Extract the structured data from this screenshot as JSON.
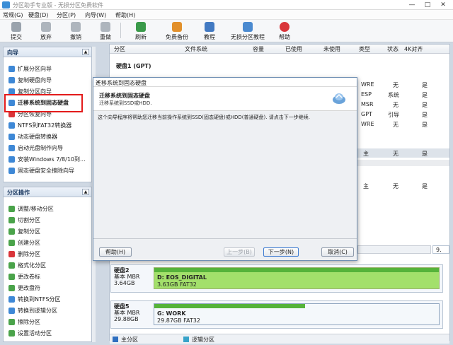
{
  "window": {
    "title": "分区助手专业版 - 无损分区免费软件",
    "minimize": "—",
    "maximize": "□",
    "close": "✕"
  },
  "menu": [
    "常规(G)",
    "硬盘(D)",
    "分区(P)",
    "向导(W)",
    "帮助(H)"
  ],
  "toolbar": [
    "提交",
    "放弃",
    "撤销",
    "重做",
    "刷新",
    "免费备份",
    "教程",
    "无损分区教程",
    "帮助"
  ],
  "wizard_panel": {
    "title": "向导",
    "items": [
      "扩展分区向导",
      "复制硬盘向导",
      "复制分区向导",
      "迁移系统到固态硬盘",
      "分区恢复向导",
      "NTFS到FAT32转换器",
      "动态硬盘转换器",
      "启动光盘制作向导",
      "安装Windows 7/8/10到...",
      "固态硬盘安全擦除向导"
    ]
  },
  "ops_panel": {
    "title": "分区操作",
    "items": [
      "调整/移动分区",
      "切割分区",
      "复制分区",
      "创建分区",
      "删除分区",
      "格式化分区",
      "更改卷标",
      "更改盘符",
      "转换到NTFS分区",
      "转换到逻辑分区",
      "擦除分区",
      "设置活动分区"
    ]
  },
  "table": {
    "columns": [
      "分区",
      "文件系统",
      "容量",
      "已使用",
      "未使用",
      "类型",
      "状态",
      "4K对齐"
    ],
    "disk1_label": "硬盘1 (GPT)",
    "rows": [
      [
        "WRE",
        "无",
        "是"
      ],
      [
        "ESP",
        "系统",
        "是"
      ],
      [
        "MSR",
        "无",
        "是"
      ],
      [
        "GPT",
        "引导",
        "是"
      ],
      [
        "WRE",
        "无",
        "是"
      ],
      [
        "主",
        "无",
        "是"
      ],
      [
        "主",
        "无",
        "是"
      ]
    ]
  },
  "dialog": {
    "title": "迁移系统到固态硬盘",
    "close": "✕",
    "heading": "迁移系统到固态硬盘",
    "subheading": "迁移系统到SSD或HDD.",
    "body": "这个向导程序将帮助您迁移当前操作系统到SSD(固态硬盘)或HDD(普通硬盘). 请点击下一步继续.",
    "help": "帮助(H)",
    "prev": "上一步(B)",
    "next": "下一步(N)",
    "cancel": "取消(C)"
  },
  "zoom": "9.",
  "disks": [
    {
      "name": "硬盘2",
      "type": "基本 MBR",
      "size": "3.64GB",
      "part": "D: EOS_DIGITAL",
      "part_info": "3.63GB FAT32",
      "used": 1.0
    },
    {
      "name": "硬盘5",
      "type": "基本 MBR",
      "size": "29.88GB",
      "part": "G: WORK",
      "part_info": "29.87GB FAT32",
      "used": 0.53
    }
  ],
  "legend": {
    "primary": "主分区",
    "logical": "逻辑分区"
  },
  "colors": {
    "accent": "#3b8ed6",
    "highlight": "#e31b1b",
    "partition": "#a3e06b"
  }
}
